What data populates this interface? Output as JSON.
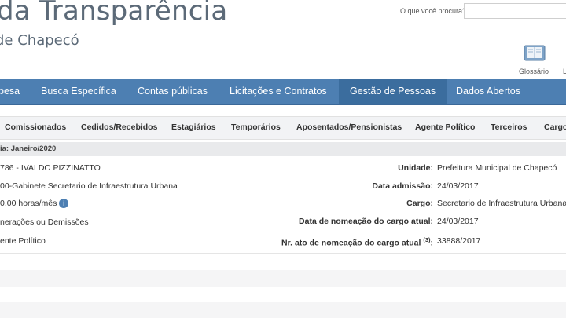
{
  "header": {
    "title": "da Transparência",
    "subtitle": "de Chapecó"
  },
  "search": {
    "label": "O que você procura?",
    "value": "",
    "placeholder": ""
  },
  "glossary": {
    "label": "Glossário",
    "extra_label": "L"
  },
  "topnav": {
    "items": [
      {
        "label": "pesa"
      },
      {
        "label": "Busca Específica"
      },
      {
        "label": "Contas públicas"
      },
      {
        "label": "Licitações e Contratos"
      },
      {
        "label": "Gestão de Pessoas",
        "active": true
      },
      {
        "label": "Dados Abertos"
      }
    ]
  },
  "subnav": {
    "items": [
      {
        "label": "Comissionados"
      },
      {
        "label": "Cedidos/Recebidos"
      },
      {
        "label": "Estagiários"
      },
      {
        "label": "Temporários"
      },
      {
        "label": "Aposentados/Pensionistas"
      },
      {
        "label": "Agente Político"
      },
      {
        "label": "Terceiros"
      },
      {
        "label": "Cargo"
      }
    ]
  },
  "reference": {
    "text": "ia: Janeiro/2020"
  },
  "details": {
    "left": [
      {
        "value": "786 - IVALDO PIZZINATTO"
      },
      {
        "value": "00-Gabinete Secretario de Infraestrutura Urbana"
      },
      {
        "value": "0,00 horas/mês"
      },
      {
        "value": "nerações ou Demissões"
      },
      {
        "value": "ente Político"
      }
    ],
    "right": [
      {
        "label": "Unidade:",
        "value": "Prefeitura Municipal de Chapecó"
      },
      {
        "label": "Data admissão:",
        "value": "24/03/2017"
      },
      {
        "label": "Cargo:",
        "value": "Secretario de Infraestrutura Urbana"
      },
      {
        "label": "Data de nomeação do cargo atual:",
        "value": "24/03/2017"
      },
      {
        "label": "Nr. ato de nomeação do cargo atual",
        "sup": "(3)",
        "suffix": ":",
        "value": "33888/2017"
      }
    ],
    "info_icon": "i"
  },
  "colors": {
    "nav_bg": "#4d7fb2",
    "nav_active": "#3b6d9e",
    "title_text": "#5c6a78",
    "subnav_bg": "#f2f3f5"
  },
  "icons": {
    "glossary": "book-icon",
    "info": "info-icon"
  }
}
